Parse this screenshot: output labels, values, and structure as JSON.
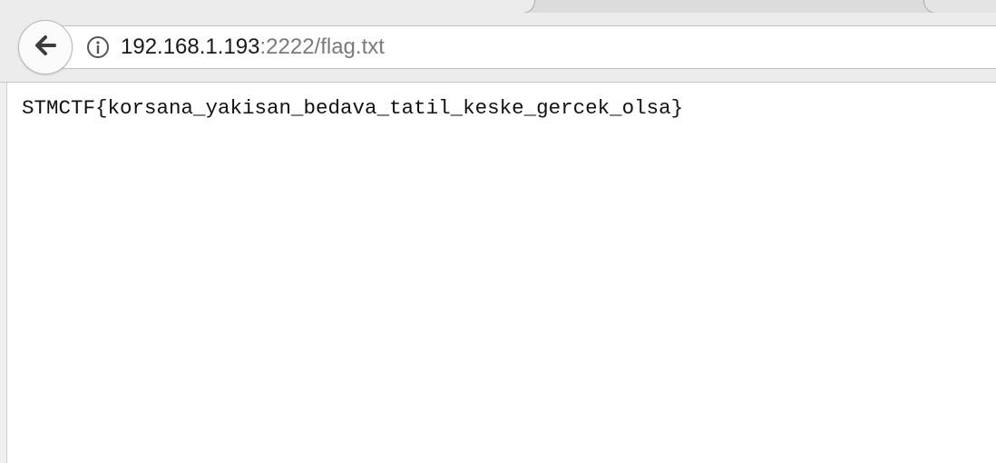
{
  "browser": {
    "toolbar": {
      "back_icon": "arrow-left-icon",
      "info_icon": "info-circle-icon"
    },
    "address_bar": {
      "host": "192.168.1.193",
      "rest": ":2222/flag.txt"
    }
  },
  "page": {
    "text": "STMCTF{korsana_yakisan_bedava_tatil_keske_gercek_olsa}"
  },
  "colors": {
    "toolbar_bg": "#ececec",
    "url_host": "#1a1a1a",
    "url_rest": "#7a7a7a",
    "page_bg": "#ffffff"
  }
}
